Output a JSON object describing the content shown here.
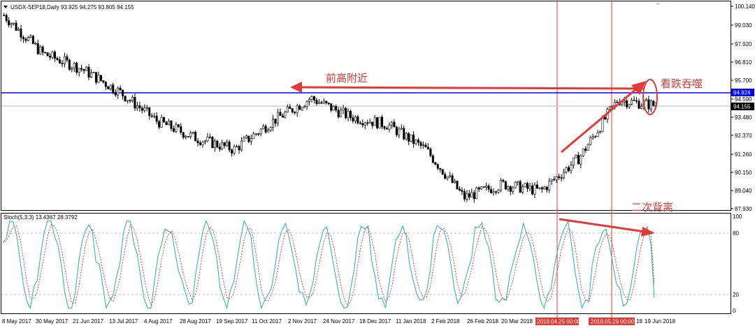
{
  "chart_data": {
    "type": "candlestick",
    "symbol_header": "USDX-SEP18,Daily  93.925 94.275 93.805 94.155",
    "y_ticks": [
      "100.140",
      "99.030",
      "97.920",
      "96.810",
      "95.700",
      "94.590",
      "93.480",
      "92.370",
      "91.260",
      "90.150",
      "89.040",
      "87.930"
    ],
    "ylim": [
      87.93,
      100.14
    ],
    "x_ticks": [
      "8 May 2017",
      "30 May 2017",
      "21 Jun 2017",
      "13 Jul 2017",
      "4 Aug 2017",
      "28 Aug 2017",
      "19 Sep 2017",
      "11 Oct 2017",
      "2 Nov 2017",
      "24 Nov 2017",
      "18 Dec 2017",
      "11 Jan 2018",
      "2 Feb 2018",
      "26 Feb 2018",
      "20 Mar 2018",
      "2018.04.25 00:00",
      "2018.05.29 00:00",
      "18",
      "19 Jun 2018"
    ],
    "price_lines": {
      "resistance": "94.924",
      "last": "94.155"
    },
    "price_series": [
      [
        "8 May 2017",
        99.6
      ],
      [
        "30 May 2017",
        97.3
      ],
      [
        "21 Jun 2017",
        96.4
      ],
      [
        "13 Jul 2017",
        95.0
      ],
      [
        "4 Aug 2017",
        93.2
      ],
      [
        "28 Aug 2017",
        92.2
      ],
      [
        "19 Sep 2017",
        91.5
      ],
      [
        "11 Oct 2017",
        93.2
      ],
      [
        "2 Nov 2017",
        94.6
      ],
      [
        "24 Nov 2017",
        93.5
      ],
      [
        "18 Dec 2017",
        93.0
      ],
      [
        "11 Jan 2018",
        91.5
      ],
      [
        "2 Feb 2018",
        88.6
      ],
      [
        "26 Feb 2018",
        89.4
      ],
      [
        "20 Mar 2018",
        89.0
      ],
      [
        "2018.04.25 00:00",
        91.0
      ],
      [
        "2018.05.29 00:00",
        94.5
      ],
      [
        "19 Jun 2018",
        94.155
      ]
    ],
    "stoch": {
      "header": "Stoch(5,3,3) 13.4367 28.3792",
      "y_ticks": [
        "100",
        "80",
        "20",
        "0"
      ],
      "ylim": [
        0,
        100
      ],
      "levels": [
        80,
        20
      ]
    },
    "annotations": {
      "prev_high": "前高附近",
      "bearish_engulfing": "看跌吞噬",
      "second_divergence": "二次背离"
    },
    "colors": {
      "candles": "#000000",
      "resistance_line": "#0000ff",
      "annotation": "#e53935",
      "stoch_main": "#20b2aa",
      "stoch_signal": "#e53935",
      "vertical_markers": "#e53935"
    }
  }
}
